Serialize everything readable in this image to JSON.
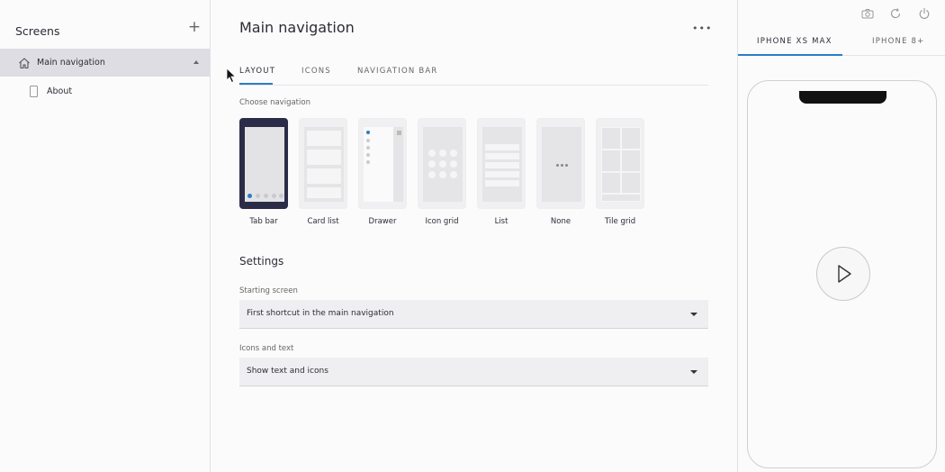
{
  "sidebar": {
    "title": "Screens",
    "add_icon": "plus-icon",
    "items": [
      {
        "label": "Main navigation",
        "icon": "home-icon",
        "active": true
      },
      {
        "label": "About",
        "icon": "page-icon",
        "active": false
      }
    ]
  },
  "main": {
    "title": "Main navigation",
    "more_icon": "more-icon",
    "tabs": [
      {
        "label": "LAYOUT",
        "active": true
      },
      {
        "label": "ICONS",
        "active": false
      },
      {
        "label": "NAVIGATION BAR",
        "active": false
      }
    ],
    "choose_label": "Choose navigation",
    "nav_options": [
      {
        "label": "Tab bar",
        "selected": true
      },
      {
        "label": "Card list",
        "selected": false
      },
      {
        "label": "Drawer",
        "selected": false
      },
      {
        "label": "Icon grid",
        "selected": false
      },
      {
        "label": "List",
        "selected": false
      },
      {
        "label": "None",
        "selected": false
      },
      {
        "label": "Tile grid",
        "selected": false
      }
    ],
    "settings_title": "Settings",
    "starting_screen": {
      "label": "Starting screen",
      "value": "First shortcut in the main navigation"
    },
    "icons_and_text": {
      "label": "Icons and text",
      "value": "Show text and icons"
    }
  },
  "preview": {
    "toolbar_icons": [
      "camera-icon",
      "refresh-icon",
      "power-icon"
    ],
    "device_tabs": [
      {
        "label": "IPHONE XS MAX",
        "active": true
      },
      {
        "label": "IPHONE 8+",
        "active": false
      }
    ],
    "play_icon": "play-icon"
  },
  "colors": {
    "accent": "#2a7ec7",
    "selected_thumb": "#2b2c47",
    "active_item_bg": "#dddde3"
  }
}
